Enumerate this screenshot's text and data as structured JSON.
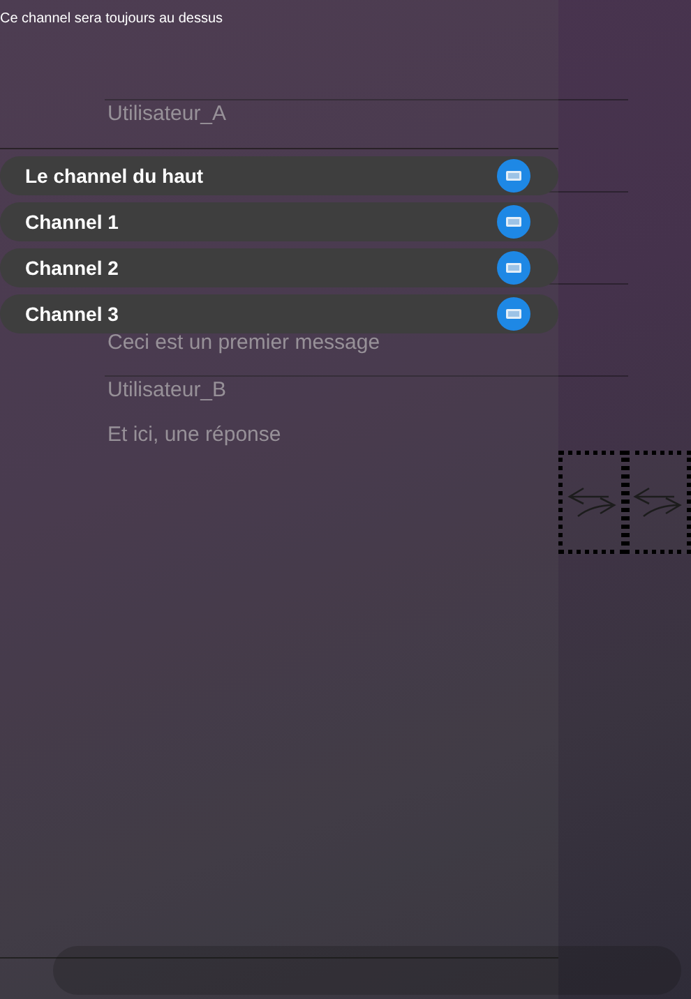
{
  "panel": {
    "title": "Ce channel sera toujours au dessus"
  },
  "channels": [
    {
      "name": "Le channel du haut"
    },
    {
      "name": "Channel 1"
    },
    {
      "name": "Channel 2"
    },
    {
      "name": "Channel 3"
    }
  ],
  "messages": [
    {
      "author": "Utilisateur_A"
    },
    {
      "text": "Ceci est un premier message"
    },
    {
      "author": "Utilisateur_B",
      "text": "Et ici, une réponse"
    }
  ]
}
